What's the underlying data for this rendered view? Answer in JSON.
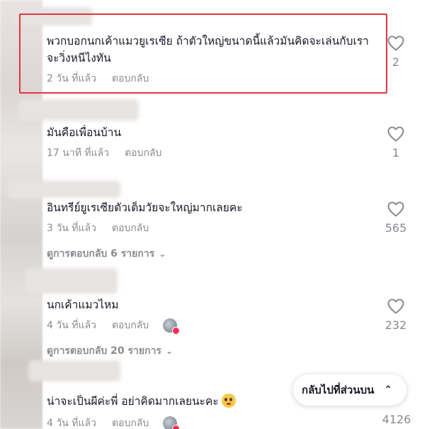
{
  "reply_label": "ตอบกลับ",
  "comments": [
    {
      "text": "พวกบอกนกเค้าแมวยูเรเซีย ถ้าตัวใหญ่ขนาดนี้แล้วมันคิดจะเล่นกับเรา จะวิ่งหนีไงทัน",
      "time": "2 วัน ที่แล้ว",
      "likes": "2"
    },
    {
      "text": "มันคือเพื่อนบ้าน",
      "time": "17 นาที ที่แล้ว",
      "likes": "1"
    },
    {
      "text": "อินทรีย์ยูเรเซียตัวเต็มวัยจะใหญ่มากเลยคะ",
      "time": "3 วัน ที่แล้ว",
      "likes": "565",
      "replies": "ดูการตอบกลับ 6 รายการ"
    },
    {
      "text": "นกเค้าแมวไหม",
      "time": "4 วัน ที่แล้ว",
      "likes": "232",
      "replies": "ดูการตอบกลับ 20 รายการ"
    },
    {
      "text": "น่าจะเป็นผีค่ะพี่ อย่าคิดมากเลยนะคะ",
      "time": "4 วัน ที่แล้ว",
      "likes": "4126"
    }
  ],
  "back_to_top": "กลับไปที่ส่วนบน",
  "colors": {
    "highlight": "#e0363c",
    "muted": "#8a8b91",
    "text": "#161823"
  },
  "icons": {
    "like": "heart-outline-icon",
    "chevron": "chevron-down-icon",
    "up": "double-chevron-up-icon"
  }
}
